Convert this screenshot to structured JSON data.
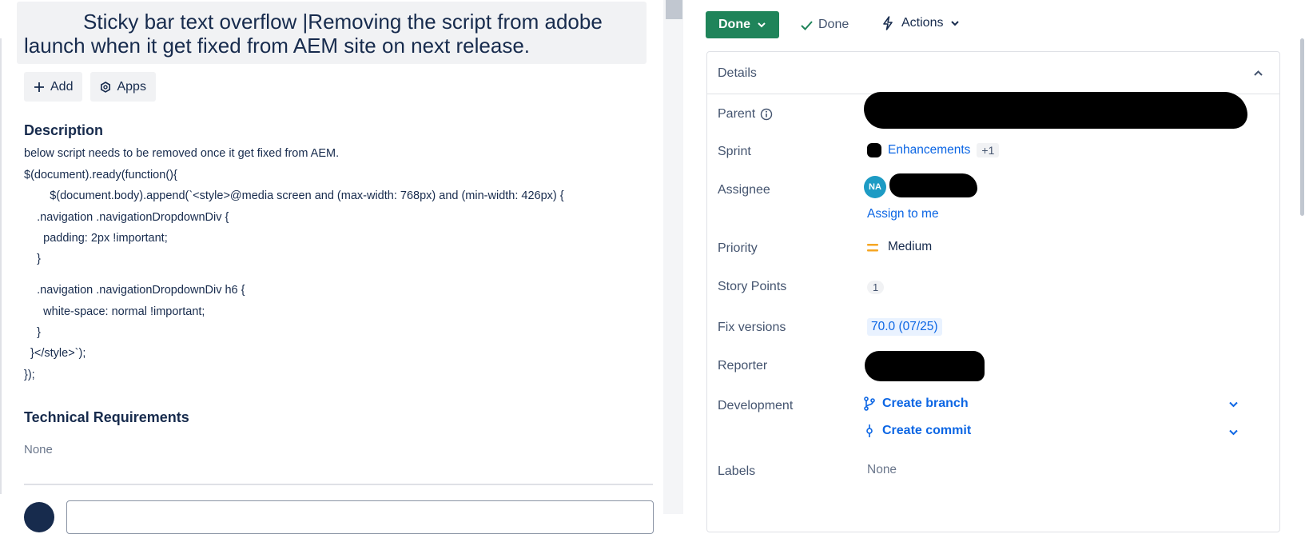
{
  "issue": {
    "title": "Sticky bar text overflow |Removing the script from adobe launch when it get fixed from AEM site on next release."
  },
  "toolbar": {
    "add_label": "Add",
    "apps_label": "Apps"
  },
  "description": {
    "heading": "Description",
    "lines": [
      "below script needs to be removed once it get fixed from AEM.",
      "$(document).ready(function(){",
      "        $(document.body).append(`<style>@media screen and (max-width: 768px) and (min-width: 426px) {",
      "    .navigation .navigationDropdownDiv {",
      "      padding: 2px !important;",
      "    }",
      "    .navigation .navigationDropdownDiv h6 {",
      "      white-space: normal !important;",
      "    }",
      "  }</style>`);",
      "});"
    ]
  },
  "technical_requirements": {
    "heading": "Technical Requirements",
    "value": "None"
  },
  "status": {
    "button_label": "Done",
    "indicator_label": "Done",
    "actions_label": "Actions"
  },
  "details": {
    "heading": "Details",
    "parent_label": "Parent",
    "sprint_label": "Sprint",
    "sprint_value": "Enhancements",
    "sprint_more": "+1",
    "assignee_label": "Assignee",
    "assignee_initials": "NA",
    "assign_to_me": "Assign to me",
    "priority_label": "Priority",
    "priority_value": "Medium",
    "story_points_label": "Story Points",
    "story_points_value": "1",
    "fix_versions_label": "Fix versions",
    "fix_versions_value": "70.0 (07/25)",
    "reporter_label": "Reporter",
    "development_label": "Development",
    "create_branch": "Create branch",
    "create_commit": "Create commit",
    "labels_label": "Labels",
    "labels_value": "None"
  },
  "colors": {
    "status_green": "#1f845a",
    "link_blue": "#0c66e4",
    "priority_orange": "#f5a623",
    "avatar_teal": "#1d9bc4"
  },
  "icons": {
    "add": "plus-icon",
    "apps": "apps-icon",
    "status_chevron": "chevron-down-icon",
    "done_check": "check-icon",
    "actions": "lightning-icon",
    "details_collapse": "chevron-up-icon",
    "parent_info": "info-icon",
    "priority": "priority-medium-icon",
    "branch": "branch-icon",
    "commit": "commit-icon"
  }
}
